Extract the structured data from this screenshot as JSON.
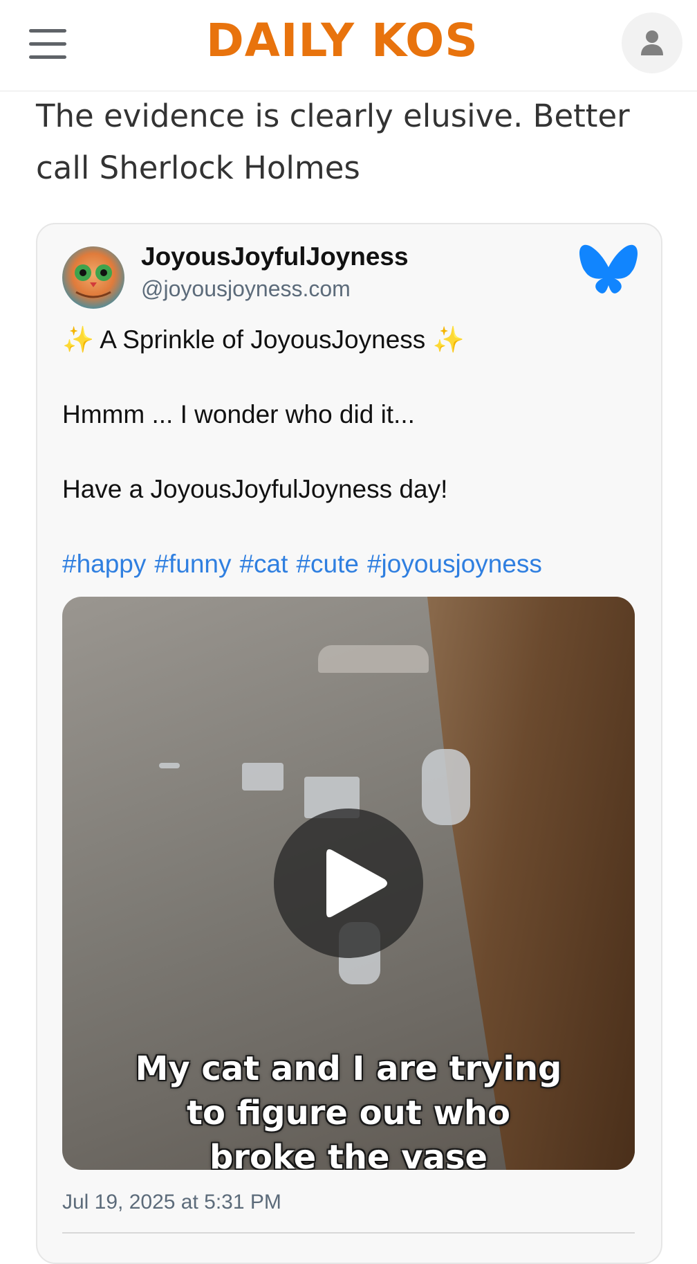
{
  "header": {
    "logo_text": "DAILY KOS",
    "logo_color": "#e8730d",
    "menu_icon": "hamburger-menu-icon",
    "account_icon": "user-account-icon"
  },
  "article": {
    "intro_text": "The evidence is clearly elusive. Better call Sherlock Holmes"
  },
  "embed": {
    "display_name": "JoyousJoyfulJoyness",
    "handle": "@joyousjoyness.com",
    "platform_icon": "bluesky-butterfly-icon",
    "platform_color": "#1185fe",
    "line1": "✨ A Sprinkle of JoyousJoyness ✨",
    "line2": "Hmmm ... I wonder who did it...",
    "line3": "Have a JoyousJoyfulJoyness day!",
    "hashtags": [
      "#happy",
      "#funny",
      "#cat",
      "#cute",
      "#joyousjoyness"
    ],
    "hashtag_color": "#2f7fe0",
    "video": {
      "caption_line1": "My cat and I are trying",
      "caption_line2": "to figure out who",
      "caption_line3": "broke the vase",
      "play_icon": "play-icon"
    },
    "timestamp": "Jul 19, 2025 at 5:31 PM"
  }
}
